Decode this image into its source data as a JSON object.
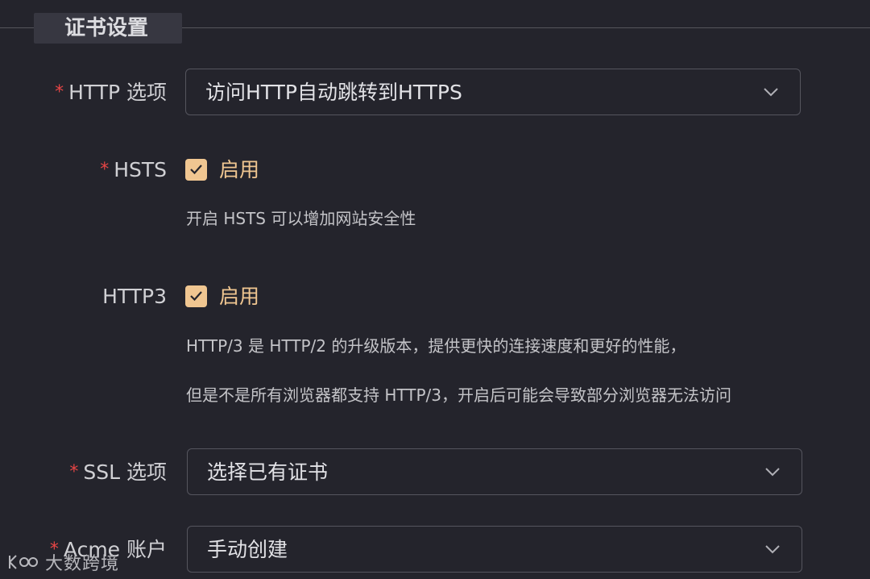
{
  "section": {
    "title": "证书设置"
  },
  "http_option": {
    "label": "HTTP 选项",
    "required": true,
    "value": "访问HTTP自动跳转到HTTPS",
    "icon": "chevron-down-icon"
  },
  "hsts": {
    "label": "HSTS",
    "required": true,
    "checked": true,
    "check_label": "启用",
    "hint": "开启 HSTS 可以增加网站安全性"
  },
  "http3": {
    "label": "HTTP3",
    "required": false,
    "checked": true,
    "check_label": "启用",
    "hint_line1": "HTTP/3 是 HTTP/2 的升级版本，提供更快的连接速度和更好的性能，",
    "hint_line2": "但是不是所有浏览器都支持 HTTP/3，开启后可能会导致部分浏览器无法访问"
  },
  "ssl_option": {
    "label": "SSL 选项",
    "required": true,
    "value": "选择已有证书",
    "icon": "chevron-down-icon"
  },
  "acme_account": {
    "label": "Acme 账户",
    "required": true,
    "value": "手动创建",
    "icon": "chevron-down-icon"
  },
  "watermark": {
    "text": "大数跨境"
  },
  "colors": {
    "background": "#24242c",
    "accent": "#f0c691",
    "required": "#e64545",
    "border": "#55555e"
  }
}
